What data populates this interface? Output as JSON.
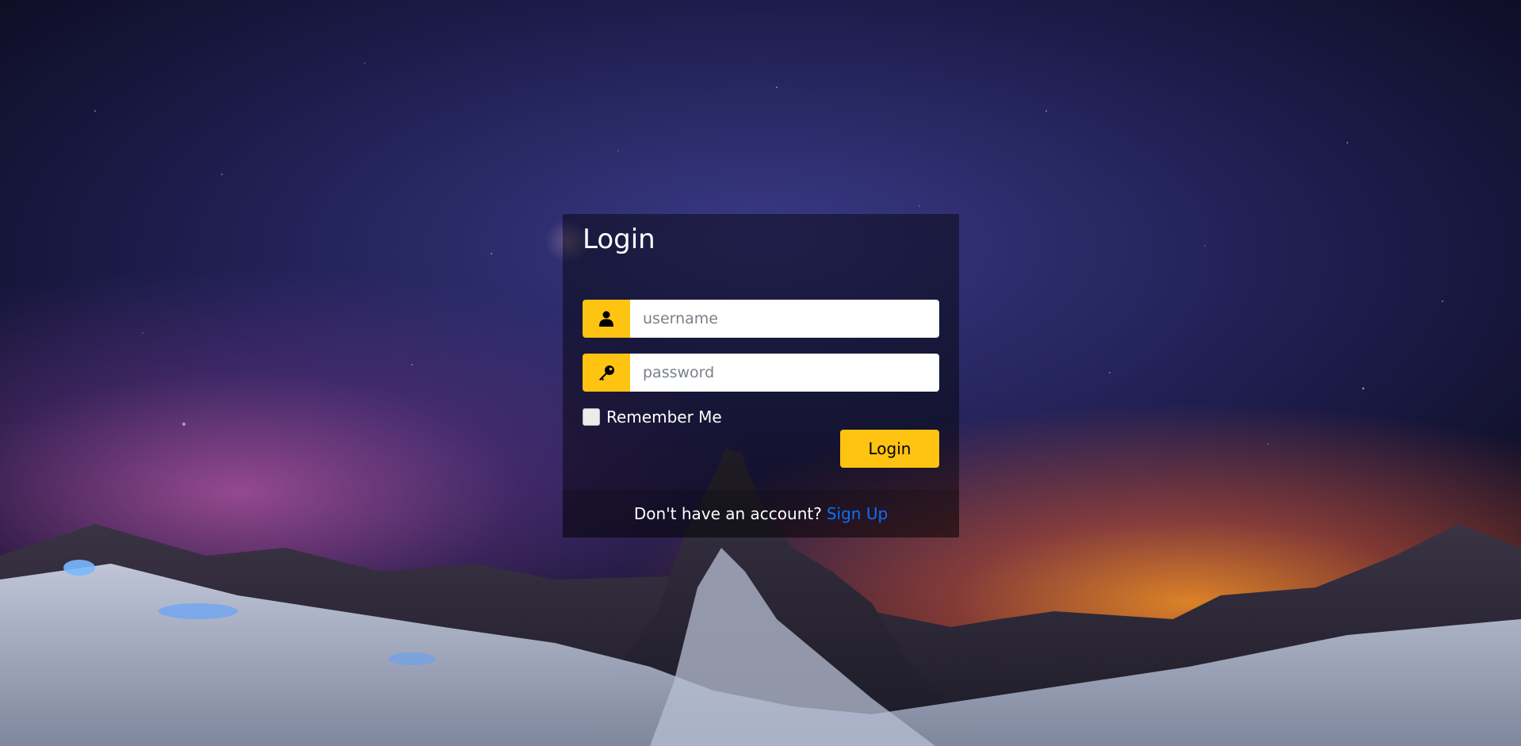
{
  "login_card": {
    "title": "Login",
    "username": {
      "placeholder": "username",
      "icon": "user-icon"
    },
    "password": {
      "placeholder": "password",
      "icon": "key-icon"
    },
    "remember_label": "Remember Me",
    "remember_checked": false,
    "submit_label": "Login",
    "footer": {
      "text": "Don't have an account?",
      "signup_link": "Sign Up"
    }
  },
  "colors": {
    "accent": "#ffc312",
    "link": "#0d6efd",
    "card_bg": "rgba(0,0,0,0.45)"
  }
}
